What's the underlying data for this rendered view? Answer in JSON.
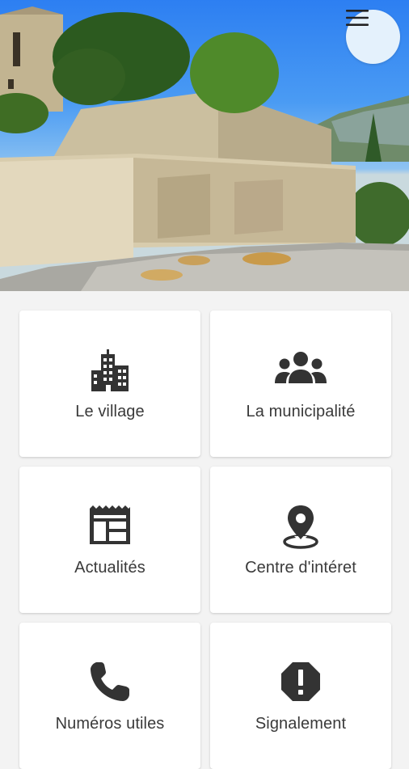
{
  "header": {
    "menu_icon": "hamburger-menu-icon"
  },
  "tiles": [
    {
      "label": "Le village",
      "icon": "city-buildings-icon"
    },
    {
      "label": "La municipalité",
      "icon": "people-group-icon"
    },
    {
      "label": "Actualités",
      "icon": "newspaper-icon"
    },
    {
      "label": "Centre d'intéret",
      "icon": "map-pin-icon"
    },
    {
      "label": "Numéros utiles",
      "icon": "phone-icon"
    },
    {
      "label": "Signalement",
      "icon": "alert-octagon-icon"
    }
  ],
  "colors": {
    "icon": "#333333",
    "tile_background": "#ffffff",
    "page_background": "#f3f3f3",
    "menu_button": "#e4f1fc"
  }
}
